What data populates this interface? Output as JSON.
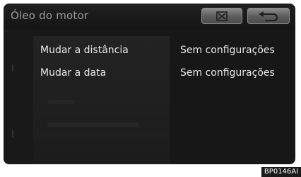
{
  "header": {
    "title": "Óleo do motor",
    "delete_icon": "delete-box-icon",
    "back_icon": "return-arrow-icon"
  },
  "rows": [
    {
      "label": "Mudar a distância",
      "value": "Sem configurações"
    },
    {
      "label": "Mudar a data",
      "value": "Sem configurações"
    }
  ],
  "image_code": "BP0146AI"
}
